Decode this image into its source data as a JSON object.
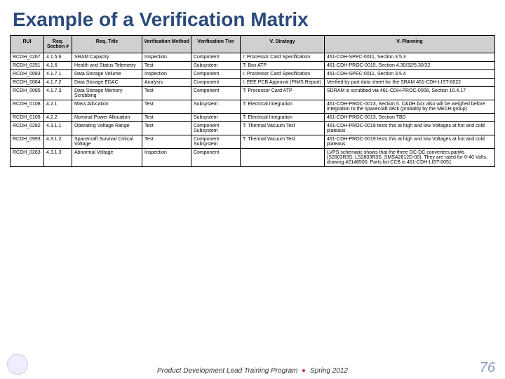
{
  "slide": {
    "title": "Example of a Verification Matrix",
    "footer_left": "Product Development Lead Training Program",
    "footer_right": "Spring 2012",
    "page_number": "76"
  },
  "table": {
    "headers": [
      "RUI",
      "Req. Section #",
      "Req. Title",
      "Verification Method",
      "Verification Tier",
      "V. Strategy",
      "V. Planning"
    ],
    "rows": [
      {
        "rui": "RCDH_0267",
        "sec": "4.1.5.6",
        "title": "SRAM Capacity",
        "method": "Inspection",
        "tier": "Component",
        "strategy": "I: Processor Card Specification",
        "planning": "461-CDH-SPEC-0011, Section 3.5.3"
      },
      {
        "rui": "RCDH_0251",
        "sec": "4.1.6",
        "title": "Health and Status Telemetry",
        "method": "Test",
        "tier": "Subsystem",
        "strategy": "T: Box ATP",
        "planning": "461-CDH-PROC-0015, Section 4.30/32/5.30/32"
      },
      {
        "rui": "RCDH_0083",
        "sec": "4.1.7.1",
        "title": "Data Storage Volume",
        "method": "Inspection",
        "tier": "Component",
        "strategy": "I: Processor Card Specification",
        "planning": "461-CDH-SPEC-0011, Section 3.5.4"
      },
      {
        "rui": "RCDH_0084",
        "sec": "4.1.7.2",
        "title": "Data Storage EDAC",
        "method": "Analysis",
        "tier": "Component",
        "strategy": "I: EEE PCB Approval (PIMS Report)",
        "planning": "Verified by part data sheet for the SRAM 461-CDH-LIST-0022"
      },
      {
        "rui": "RCDH_0085",
        "sec": "4.1.7.3",
        "title": "Data Storage Memory Scrubbing",
        "method": "Test",
        "tier": "Component",
        "strategy": "T: Processor Card ATP",
        "planning": "SDRAM is scrubbed via 461-CDH-PROC-0008, Section 10.4.17"
      },
      {
        "rui": "RCDH_0108",
        "sec": "4.2.1",
        "title": "Mass Allocation",
        "method": "Test",
        "tier": "Subsystem",
        "strategy": "T: Electrical Integration",
        "planning": "461-CDH-PROC-0013, Section 5.  C&DH box also will be weighed before integration to the spacecraft deck (probably by the MECH group)"
      },
      {
        "rui": "RCDH_0109",
        "sec": "4.2.2",
        "title": "Nominal Power Allocation",
        "method": "Test",
        "tier": "Subsystem",
        "strategy": "T: Electrical Integration",
        "planning": "461-CDH-PROC-0013, Section TBD"
      },
      {
        "rui": "RCDH_0282",
        "sec": "4.3.1.1",
        "title": "Operating Voltage Range",
        "method": "Test",
        "tier": "Component Subsystem",
        "strategy": "T: Thermal Vacuum Test",
        "planning": "461-CDH-PROC-0019 tests this at high and low Voltages at hot and cold plateaus"
      },
      {
        "rui": "RCDH_0993",
        "sec": "4.3.1.2",
        "title": "Spacecraft Survival Critical Voltage",
        "method": "Test",
        "tier": "Component Subsystem",
        "strategy": "T: Thermal Vacuum Test",
        "planning": "461-CDH-PROC-0019 tests this at high and low Voltages at hot and cold plateaus"
      },
      {
        "rui": "RCDH_0283",
        "sec": "4.3.1.3",
        "title": "Abnormal Voltage",
        "method": "Inspection",
        "tier": "Component",
        "strategy": "",
        "planning": "LVPS schematic shows that the three DC-DC converters part#s (S2803R3S, LS2803R3S, SMSA2812D-00). They are rated for 0-40 Volts, drawing #2148500. Parts list CCB is 461-CDH-LIST-0051"
      }
    ]
  }
}
